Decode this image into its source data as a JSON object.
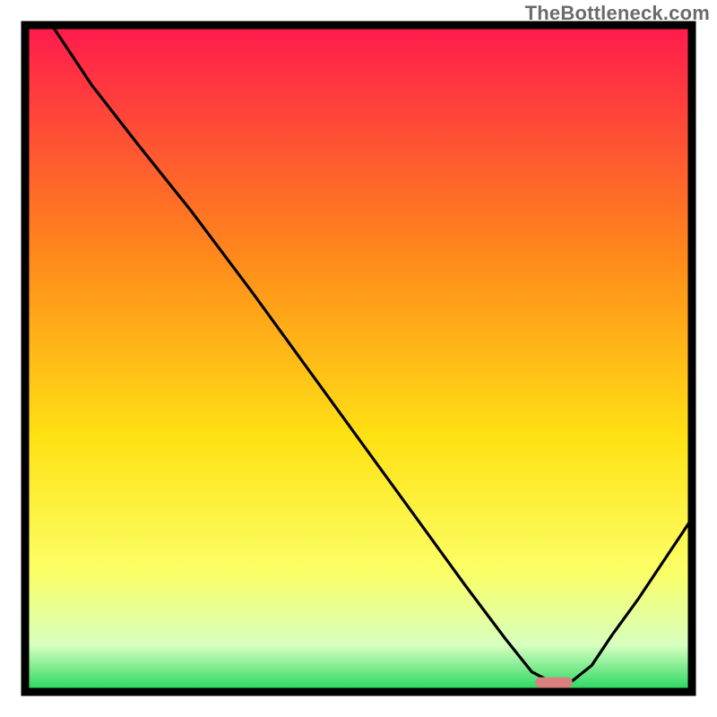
{
  "watermark": "TheBottleneck.com",
  "chart_data": {
    "type": "line",
    "title": "",
    "xlabel": "",
    "ylabel": "",
    "xlim": [
      0,
      100
    ],
    "ylim": [
      0,
      100
    ],
    "background": "red-yellow-green vertical gradient (heatmap style), green concentrated at the bottom",
    "series": [
      {
        "name": "curve",
        "x": [
          4,
          10,
          17,
          25,
          34,
          42,
          50,
          58,
          66,
          72,
          76,
          79.5,
          82,
          85,
          88,
          92,
          96,
          100
        ],
        "y": [
          100,
          91,
          82,
          72,
          60,
          49,
          38,
          27,
          16,
          8,
          3,
          1.2,
          1.6,
          4,
          8.5,
          14,
          20,
          26
        ]
      }
    ],
    "marker": {
      "name": "optimum-pill",
      "x": 79.3,
      "y": 1.4,
      "width": 5.6,
      "height": 1.6,
      "color": "#d9817f"
    },
    "colors": {
      "curve": "#000000",
      "border": "#000000",
      "grad_top": "#ff1a4d",
      "grad_mid1": "#ff8a1a",
      "grad_mid2": "#ffe214",
      "grad_mid3": "#fbff66",
      "grad_low": "#d7ffbf",
      "grad_bottom": "#1fd65c"
    }
  }
}
